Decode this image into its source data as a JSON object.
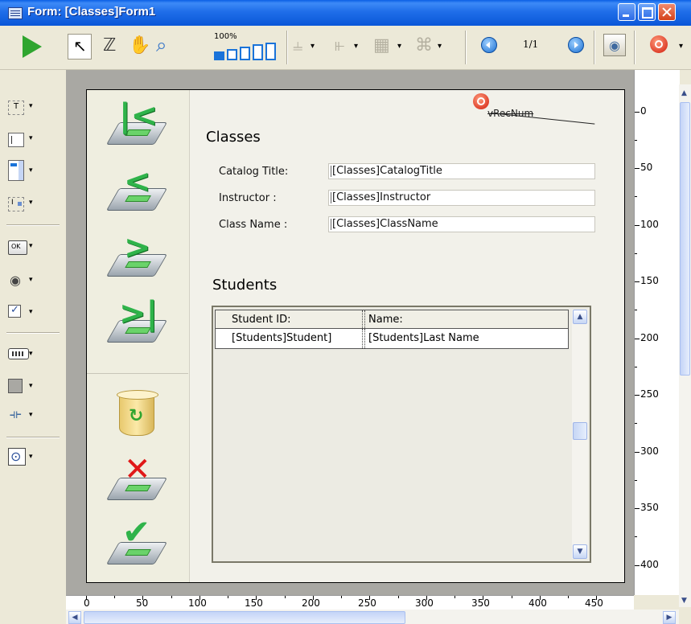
{
  "window": {
    "title": "Form: [Classes]Form1"
  },
  "toolbar": {
    "zoom_label": "100%",
    "page_indicator": "1/1"
  },
  "form": {
    "title": "Classes",
    "fields": [
      {
        "label": "Catalog Title:",
        "value": "[Classes]CatalogTitle"
      },
      {
        "label": "Instructor :",
        "value": "[Classes]Instructor"
      },
      {
        "label": "Class Name :",
        "value": "[Classes]ClassName"
      }
    ],
    "recnum_var": "vRecNum",
    "subform_title": "Students",
    "listbox": {
      "headers": [
        "Student ID:",
        "Name:"
      ],
      "rows": [
        [
          "[Students]Student]",
          "[Students]Last Name"
        ]
      ]
    }
  },
  "rulers": {
    "vertical": [
      "0",
      "50",
      "100",
      "150",
      "200",
      "250",
      "300",
      "350",
      "400"
    ],
    "horizontal": [
      "0",
      "50",
      "100",
      "150",
      "200",
      "250",
      "300",
      "350",
      "400",
      "450"
    ]
  }
}
